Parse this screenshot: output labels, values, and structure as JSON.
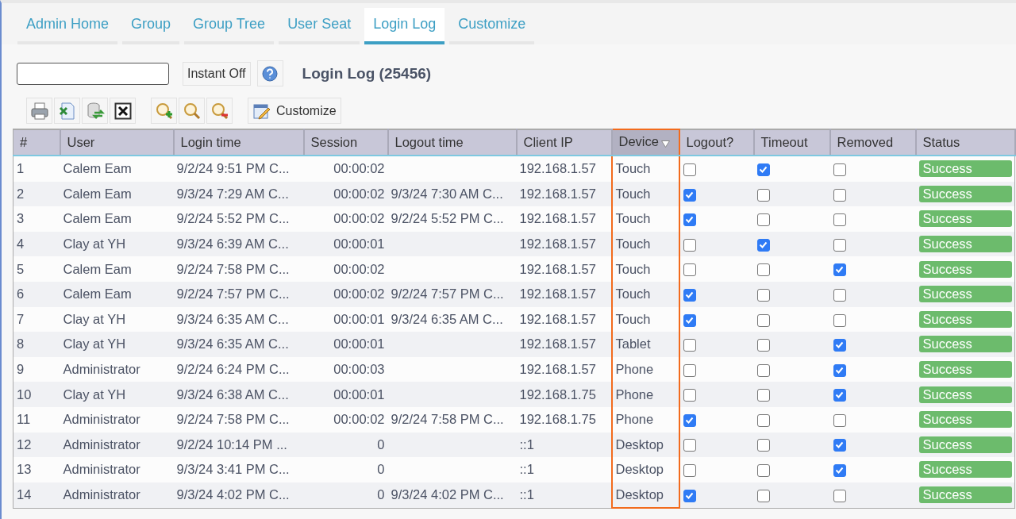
{
  "tabs": [
    {
      "label": "Admin Home",
      "selected": false
    },
    {
      "label": "Group",
      "selected": false
    },
    {
      "label": "Group Tree",
      "selected": false
    },
    {
      "label": "User Seat",
      "selected": false
    },
    {
      "label": "Login Log",
      "selected": true
    },
    {
      "label": "Customize",
      "selected": false
    }
  ],
  "instant_button": "Instant Off",
  "title": "Login Log (25456)",
  "customize_button": "Customize",
  "table": {
    "columns": [
      {
        "label": "#",
        "sorted": false,
        "highlighted": false
      },
      {
        "label": "User",
        "sorted": false,
        "highlighted": false
      },
      {
        "label": "Login time",
        "sorted": false,
        "highlighted": false
      },
      {
        "label": "Session",
        "sorted": false,
        "highlighted": false
      },
      {
        "label": "Logout time",
        "sorted": false,
        "highlighted": false
      },
      {
        "label": "Client IP",
        "sorted": false,
        "highlighted": false
      },
      {
        "label": "Device",
        "sorted": true,
        "highlighted": true
      },
      {
        "label": "Logout?",
        "sorted": false,
        "highlighted": false
      },
      {
        "label": "Timeout",
        "sorted": false,
        "highlighted": false
      },
      {
        "label": "Removed",
        "sorted": false,
        "highlighted": false
      },
      {
        "label": "Status",
        "sorted": false,
        "highlighted": false
      }
    ],
    "rows": [
      {
        "num": "1",
        "user": "Calem Eam",
        "login_time": "9/2/24 9:51 PM C...",
        "session": "00:00:02",
        "logout_time": "",
        "client_ip": "192.168.1.57",
        "device": "Touch",
        "logout": false,
        "timeout": true,
        "removed": false,
        "status": "Success"
      },
      {
        "num": "2",
        "user": "Calem Eam",
        "login_time": "9/3/24 7:29 AM C...",
        "session": "00:00:02",
        "logout_time": "9/3/24 7:30 AM C...",
        "client_ip": "192.168.1.57",
        "device": "Touch",
        "logout": true,
        "timeout": false,
        "removed": false,
        "status": "Success"
      },
      {
        "num": "3",
        "user": "Calem Eam",
        "login_time": "9/2/24 5:52 PM C...",
        "session": "00:00:02",
        "logout_time": "9/2/24 5:52 PM C...",
        "client_ip": "192.168.1.57",
        "device": "Touch",
        "logout": true,
        "timeout": false,
        "removed": false,
        "status": "Success"
      },
      {
        "num": "4",
        "user": "Clay at YH",
        "login_time": "9/3/24 6:39 AM C...",
        "session": "00:00:01",
        "logout_time": "",
        "client_ip": "192.168.1.57",
        "device": "Touch",
        "logout": false,
        "timeout": true,
        "removed": false,
        "status": "Success"
      },
      {
        "num": "5",
        "user": "Calem Eam",
        "login_time": "9/2/24 7:58 PM C...",
        "session": "00:00:02",
        "logout_time": "",
        "client_ip": "192.168.1.57",
        "device": "Touch",
        "logout": false,
        "timeout": false,
        "removed": true,
        "status": "Success"
      },
      {
        "num": "6",
        "user": "Calem Eam",
        "login_time": "9/2/24 7:57 PM C...",
        "session": "00:00:02",
        "logout_time": "9/2/24 7:57 PM C...",
        "client_ip": "192.168.1.57",
        "device": "Touch",
        "logout": true,
        "timeout": false,
        "removed": false,
        "status": "Success"
      },
      {
        "num": "7",
        "user": "Clay at YH",
        "login_time": "9/3/24 6:35 AM C...",
        "session": "00:00:01",
        "logout_time": "9/3/24 6:35 AM C...",
        "client_ip": "192.168.1.57",
        "device": "Touch",
        "logout": true,
        "timeout": false,
        "removed": false,
        "status": "Success"
      },
      {
        "num": "8",
        "user": "Clay at YH",
        "login_time": "9/3/24 6:35 AM C...",
        "session": "00:00:01",
        "logout_time": "",
        "client_ip": "192.168.1.57",
        "device": "Tablet",
        "logout": false,
        "timeout": false,
        "removed": true,
        "status": "Success"
      },
      {
        "num": "9",
        "user": "Administrator",
        "login_time": "9/2/24 6:24 PM C...",
        "session": "00:00:03",
        "logout_time": "",
        "client_ip": "192.168.1.57",
        "device": "Phone",
        "logout": false,
        "timeout": false,
        "removed": true,
        "status": "Success"
      },
      {
        "num": "10",
        "user": "Clay at YH",
        "login_time": "9/3/24 6:38 AM C...",
        "session": "00:00:01",
        "logout_time": "",
        "client_ip": "192.168.1.75",
        "device": "Phone",
        "logout": false,
        "timeout": false,
        "removed": true,
        "status": "Success"
      },
      {
        "num": "11",
        "user": "Administrator",
        "login_time": "9/2/24 7:58 PM C...",
        "session": "00:00:02",
        "logout_time": "9/2/24 7:58 PM C...",
        "client_ip": "192.168.1.75",
        "device": "Phone",
        "logout": true,
        "timeout": false,
        "removed": false,
        "status": "Success"
      },
      {
        "num": "12",
        "user": "Administrator",
        "login_time": "9/2/24 10:14 PM ...",
        "session": "0",
        "logout_time": "",
        "client_ip": "::1",
        "device": "Desktop",
        "logout": false,
        "timeout": false,
        "removed": true,
        "status": "Success"
      },
      {
        "num": "13",
        "user": "Administrator",
        "login_time": "9/3/24 3:41 PM C...",
        "session": "0",
        "logout_time": "",
        "client_ip": "::1",
        "device": "Desktop",
        "logout": false,
        "timeout": false,
        "removed": true,
        "status": "Success"
      },
      {
        "num": "14",
        "user": "Administrator",
        "login_time": "9/3/24 4:02 PM C...",
        "session": "0",
        "logout_time": "9/3/24 4:02 PM C...",
        "client_ip": "::1",
        "device": "Desktop",
        "logout": true,
        "timeout": false,
        "removed": false,
        "status": "Success"
      }
    ]
  }
}
